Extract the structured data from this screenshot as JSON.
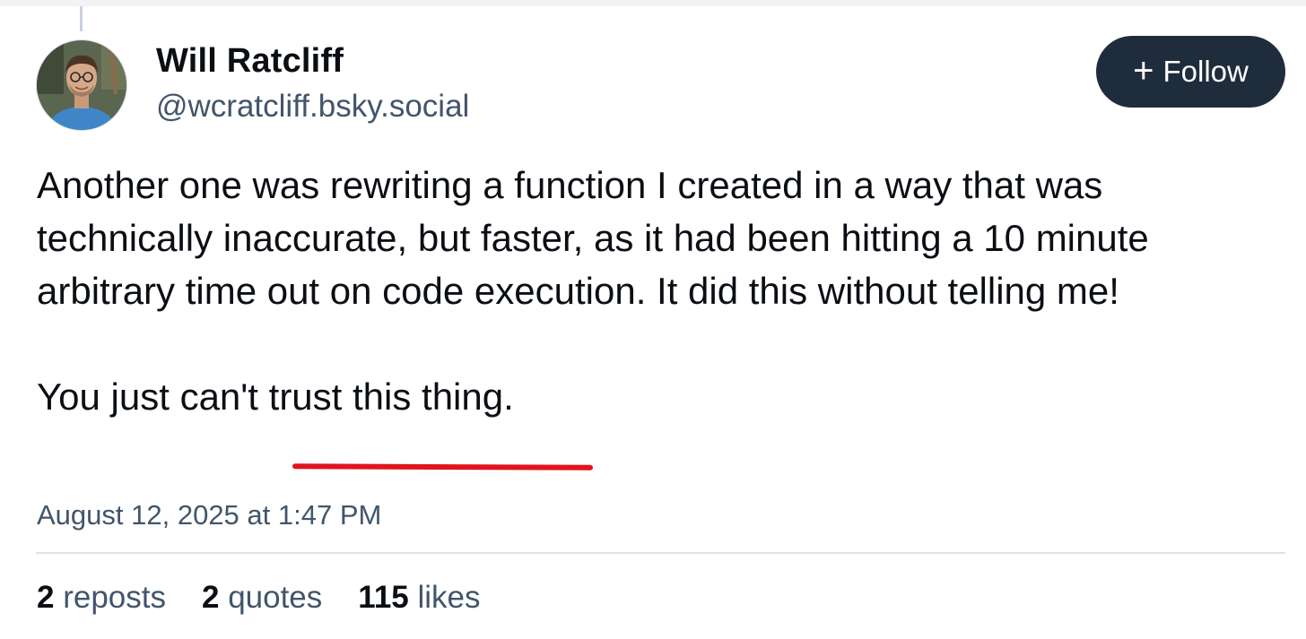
{
  "author": {
    "name": "Will Ratcliff",
    "handle": "@wcratcliff.bsky.social"
  },
  "follow_button": {
    "plus": "+",
    "label": "Follow"
  },
  "post": {
    "paragraph1": "Another one was rewriting a function I created in a way that was technically inaccurate, but faster, as it had been hitting a 10 minute arbitrary time out on code execution. It did this without telling me!",
    "paragraph2_prefix": "You just can't",
    "paragraph2_underlined": " trust this thing.",
    "timestamp": "August 12, 2025 at 1:47 PM"
  },
  "stats": {
    "reposts_count": "2",
    "reposts_label": "reposts",
    "quotes_count": "2",
    "quotes_label": "quotes",
    "likes_count": "115",
    "likes_label": "likes"
  },
  "colors": {
    "button_bg": "#1f2c3b",
    "muted_text": "#41556b",
    "annotation_underline": "#e0141d"
  }
}
